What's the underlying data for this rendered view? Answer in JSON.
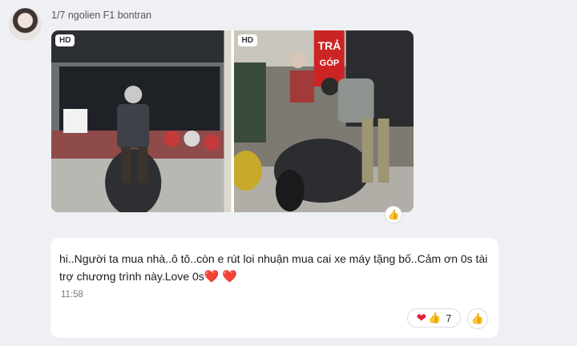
{
  "sender": {
    "label": "1/7 ngolien F1 bontran"
  },
  "photos": [
    {
      "badge": "HD"
    },
    {
      "badge": "HD"
    }
  ],
  "photo_sign": {
    "line1": "TRẢ",
    "line2": "GÓP"
  },
  "message": {
    "text": "hi..Người ta mua nhà..ô tô..còn e rút loi nhuận mua cai xe máy tặng bố..Cảm ơn 0s tài trợ chương trình này.Love 0s",
    "time": "11:58"
  },
  "reactions": {
    "count": "7",
    "icons": [
      "heart-icon",
      "thumbs-up-icon"
    ]
  },
  "colors": {
    "heart": "#e0213a",
    "thumb": "#f0b12f",
    "background": "#eef0f3"
  }
}
